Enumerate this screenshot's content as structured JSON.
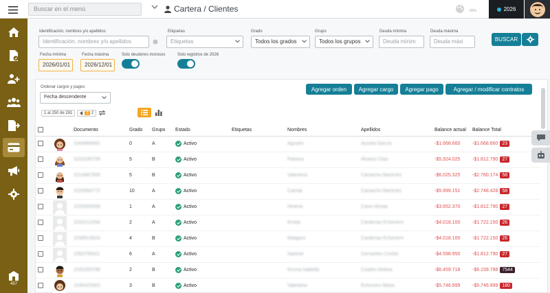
{
  "topbar": {
    "search_placeholder": "Buscar en el menú",
    "title": "Cartera / Clientes",
    "year_label": "2026",
    "pct_label": "05%"
  },
  "sidebar": {
    "items": [
      "home",
      "documents",
      "user-add",
      "users",
      "export",
      "billing",
      "megaphone",
      "settings"
    ],
    "footer_count": "457"
  },
  "filters": {
    "ident_label": "Identificación, nombres y/o apellidos",
    "ident_placeholder": "Identificación, nombres y/o apellidos",
    "etiquetas_label": "Etiquetas",
    "etiquetas_placeholder": "Etiquetas",
    "grado_label": "Grado",
    "grado_value": "Todos los grados",
    "grupo_label": "Grupo",
    "grupo_value": "Todos los grupos",
    "deuda_min_label": "Deuda mínima",
    "deuda_min_placeholder": "Deuda mínim",
    "deuda_max_label": "Deuda máxima",
    "deuda_max_placeholder": "Deuda máxi",
    "fecha_min_label": "Fecha mínima",
    "fecha_min_value": "2026/01/01",
    "fecha_max_label": "Fecha máxima",
    "fecha_max_value": "2026/12/01",
    "solo_deudores_label": "Solo deudores morosos",
    "solo_registros_label": "Solo registros de 2026",
    "buscar_label": "BUSCAR"
  },
  "actions": {
    "agregar_orden": "Agregar orden",
    "agregar_cargo": "Agregar cargo",
    "agregar_pago": "Agregar pago",
    "agregar_contratos": "Agregar / modificar contratos"
  },
  "sorting": {
    "label": "Ordenar cargos y pagos",
    "value": "Fecha descendente"
  },
  "pager": {
    "range": "1 al 250 de 281",
    "page1": "1",
    "page2": "2"
  },
  "table": {
    "headers": [
      "Documento",
      "Grado",
      "Grupo",
      "Estado",
      "Etiquetas",
      "Nombres",
      "Apellidos",
      "Balance actual",
      "Balance Total"
    ],
    "rows": [
      {
        "doc": "1044889491",
        "grado": "0",
        "grupo": "A",
        "estado": "Activo",
        "nombres": "Agustín",
        "apellidos": "Acosta García",
        "bal": "-$1.668.660",
        "total": "-$1.668.660",
        "badge": "23",
        "avatar": "girl",
        "badge_dark": false
      },
      {
        "doc": "1023295706",
        "grado": "5",
        "grupo": "B",
        "estado": "Activo",
        "nombres": "Paloma",
        "apellidos": "Álvarez Díaz",
        "bal": "-$5.924.025",
        "total": "-$1.812.790",
        "badge": "27",
        "avatar": "woman",
        "badge_dark": false
      },
      {
        "doc": "1014887955",
        "grado": "5",
        "grupo": "B",
        "estado": "Activo",
        "nombres": "Valentina",
        "apellidos": "Camacho Martínez",
        "bal": "-$6.025.325",
        "total": "-$2.760.174",
        "badge": "58",
        "avatar": "girl2",
        "badge_dark": false
      },
      {
        "doc": "1028984772",
        "grado": "10",
        "grupo": "A",
        "estado": "Activo",
        "nombres": "Camila",
        "apellidos": "Camacho Martínez",
        "bal": "-$5.999.151",
        "total": "-$2.748.428",
        "badge": "58",
        "avatar": "boy",
        "badge_dark": false
      },
      {
        "doc": "1025000936",
        "grado": "1",
        "grupo": "A",
        "estado": "Activo",
        "nombres": "Helena",
        "apellidos": "Cano Henao",
        "bal": "-$3.652.370",
        "total": "-$1.812.790",
        "badge": "27",
        "avatar": "blank",
        "badge_dark": false
      },
      {
        "doc": "1020213284",
        "grado": "2",
        "grupo": "A",
        "estado": "Activo",
        "nombres": "Emilia",
        "apellidos": "Cárdenas Echeverri",
        "bal": "-$4.018.100",
        "total": "-$1.722.150",
        "badge": "26",
        "avatar": "blank",
        "badge_dark": false
      },
      {
        "doc": "1039513024",
        "grado": "4",
        "grupo": "B",
        "estado": "Activo",
        "nombres": "Milagros",
        "apellidos": "Cárdenas Echeverri",
        "bal": "-$4.018.100",
        "total": "-$1.722.150",
        "badge": "26",
        "avatar": "blank",
        "badge_dark": false
      },
      {
        "doc": "1083795411",
        "grado": "6",
        "grupo": "A",
        "estado": "Activo",
        "nombres": "Salomé",
        "apellidos": "Cervantes Cortés",
        "bal": "-$4.598.950",
        "total": "-$1.812.790",
        "badge": "27",
        "avatar": "blank",
        "badge_dark": false
      },
      {
        "doc": "1033263798",
        "grado": "2",
        "grupo": "B",
        "estado": "Activo",
        "nombres": "Emma Isabella",
        "apellidos": "Cuadro Molina",
        "bal": "-$6.459.718",
        "total": "-$6.159.788",
        "badge": "7544",
        "avatar": "boy2",
        "badge_dark": true
      },
      {
        "doc": "1030425302",
        "grado": "3",
        "grupo": "B",
        "estado": "Activo",
        "nombres": "Valentina",
        "apellidos": "Echeverri Mejía",
        "bal": "-$5.746.999",
        "total": "-$5.746.999",
        "badge": "180",
        "avatar": "girl3",
        "badge_dark": false
      }
    ]
  },
  "colors": {
    "sidebar": "#7a6014",
    "accent": "#157f97",
    "negative": "#e05050",
    "badge": "#c9262c"
  }
}
